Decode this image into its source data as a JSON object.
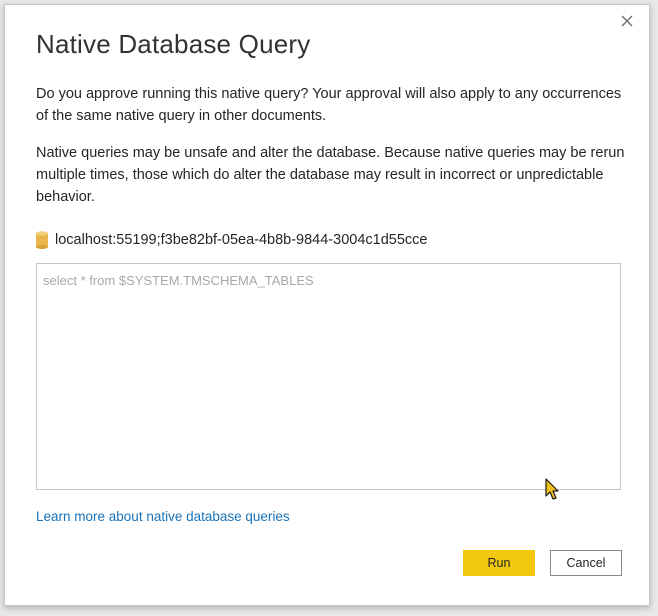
{
  "dialog": {
    "title": "Native Database Query",
    "paragraph1": "Do you approve running this native query? Your approval will also apply to any occurrences of the same native query in other documents.",
    "paragraph2": "Native queries may be unsafe and alter the database. Because native queries may be rerun multiple times, those which do alter the database may result in incorrect or unpredictable behavior.",
    "source": "localhost:55199;f3be82bf-05ea-4b8b-9844-3004c1d55cce",
    "query": "select * from $SYSTEM.TMSCHEMA_TABLES",
    "learn_more": "Learn more about native database queries",
    "run_label": "Run",
    "cancel_label": "Cancel"
  },
  "icons": {
    "close": "close-icon",
    "database": "database-icon",
    "cursor": "mouse-pointer-icon"
  },
  "colors": {
    "accent": "#f2c811",
    "link": "#1a73b8",
    "database_icon": "#e8b64a"
  }
}
